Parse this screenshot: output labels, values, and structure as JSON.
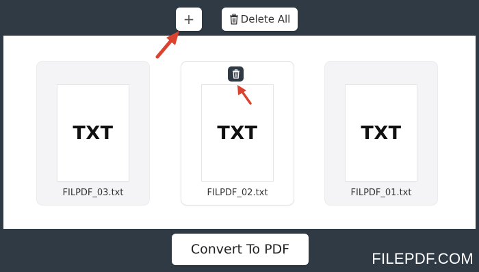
{
  "toolbar": {
    "add_label": "+",
    "delete_all_label": "Delete All"
  },
  "files": [
    {
      "type_label": "TXT",
      "name": "FILPDF_03.txt",
      "selected": false
    },
    {
      "type_label": "TXT",
      "name": "FILPDF_02.txt",
      "selected": true
    },
    {
      "type_label": "TXT",
      "name": "FILPDF_01.txt",
      "selected": false
    }
  ],
  "convert_label": "Convert To PDF",
  "brand": "FILEPDF.COM",
  "colors": {
    "frame": "#2f3a44",
    "workspace": "#ffffff",
    "arrow": "#d9432f"
  },
  "icons": {
    "add": "plus-icon",
    "delete_all": "trash-icon",
    "card_delete": "trash-icon"
  }
}
